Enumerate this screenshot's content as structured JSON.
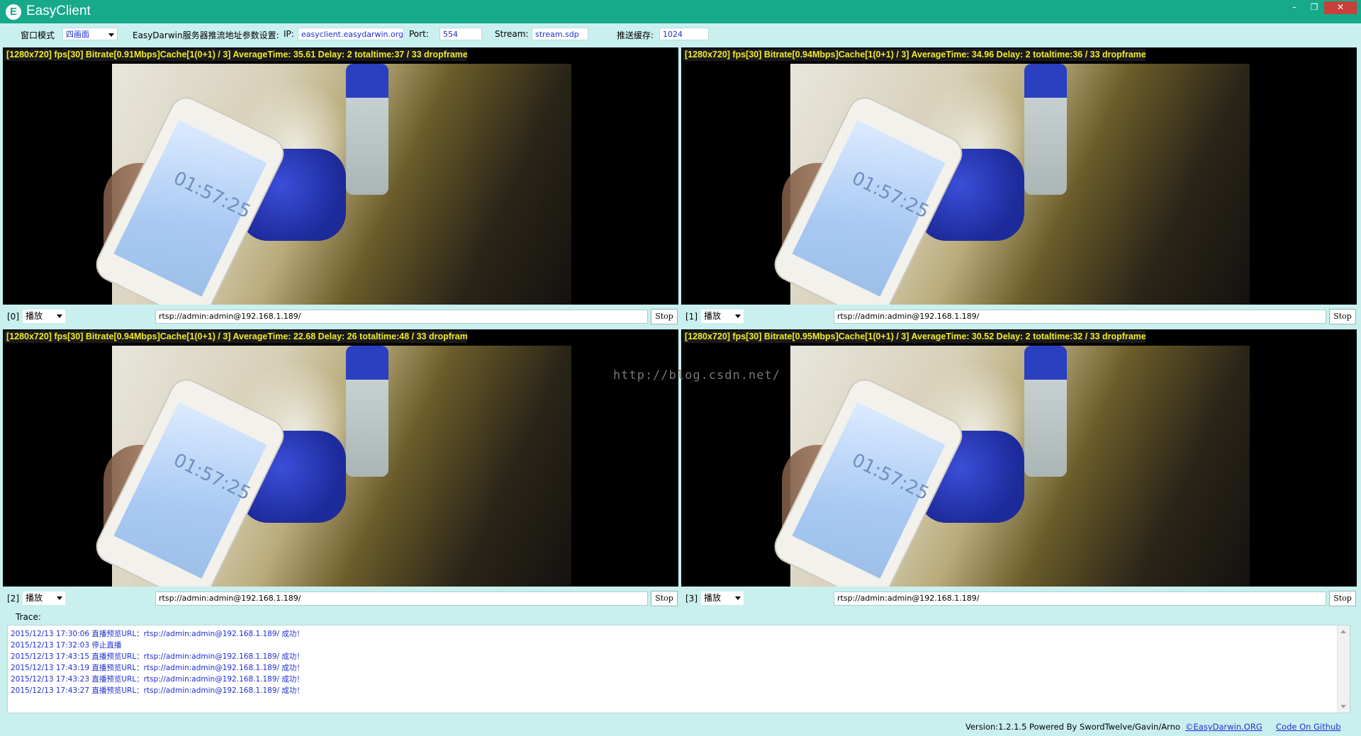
{
  "app": {
    "title": "EasyClient",
    "logo_letter": "E"
  },
  "window_controls": {
    "minimize": "–",
    "restore": "❐",
    "close": "✕"
  },
  "toolbar": {
    "window_mode_label": "窗口模式",
    "window_mode_value": "四画面",
    "server_label": "EasyDarwin服务器推流地址参数设置:",
    "ip_label": "IP:",
    "ip_value": "easyclient.easydarwin.org",
    "port_label": "Port:",
    "port_value": "554",
    "stream_label": "Stream:",
    "stream_value": "stream.sdp",
    "cache_label": "推送缓存:",
    "cache_value": "1024"
  },
  "channels": [
    {
      "index": "[0]",
      "mode": "播放",
      "url": "rtsp://admin:admin@192.168.1.189/",
      "stop_label": "Stop",
      "stats": "[1280x720] fps[30] Bitrate[0.91Mbps]Cache[1(0+1) / 3]  AverageTime: 35.61  Delay: 2  totaltime:37 / 33 dropframe:0"
    },
    {
      "index": "[1]",
      "mode": "播放",
      "url": "rtsp://admin:admin@192.168.1.189/",
      "stop_label": "Stop",
      "stats": "[1280x720] fps[30] Bitrate[0.94Mbps]Cache[1(0+1) / 3]  AverageTime: 34.96  Delay: 2  totaltime:36 / 33 dropframe:0"
    },
    {
      "index": "[2]",
      "mode": "播放",
      "url": "rtsp://admin:admin@192.168.1.189/",
      "stop_label": "Stop",
      "stats": "[1280x720] fps[30] Bitrate[0.94Mbps]Cache[1(0+1) / 3]  AverageTime: 22.68  Delay: 26  totaltime:48 / 33 dropframe:0"
    },
    {
      "index": "[3]",
      "mode": "播放",
      "url": "rtsp://admin:admin@192.168.1.189/",
      "stop_label": "Stop",
      "stats": "[1280x720] fps[30] Bitrate[0.95Mbps]Cache[1(0+1) / 3]  AverageTime: 30.52  Delay: 2  totaltime:32 / 33 dropframe:0"
    }
  ],
  "video_overlay": {
    "clock_text": "01:57:25"
  },
  "watermark": "http://blog.csdn.net/",
  "trace": {
    "label": "Trace:",
    "lines": [
      "2015/12/13 17:30:06   直播预览URL：rtsp://admin:admin@192.168.1.189/ 成功！",
      "2015/12/13 17:32:03   停止直播",
      "2015/12/13 17:43:15   直播预览URL：rtsp://admin:admin@192.168.1.189/ 成功！",
      "2015/12/13 17:43:19   直播预览URL：rtsp://admin:admin@192.168.1.189/ 成功！",
      "2015/12/13 17:43:23   直播预览URL：rtsp://admin:admin@192.168.1.189/ 成功！",
      "2015/12/13 17:43:27   直播预览URL：rtsp://admin:admin@192.168.1.189/ 成功！"
    ]
  },
  "footer": {
    "version_text": "Version:1.2.1.5 Powered By SwordTwelve/Gavin/Arno",
    "site_link": "©EasyDarwin.ORG",
    "github_link": "Code On Github"
  }
}
